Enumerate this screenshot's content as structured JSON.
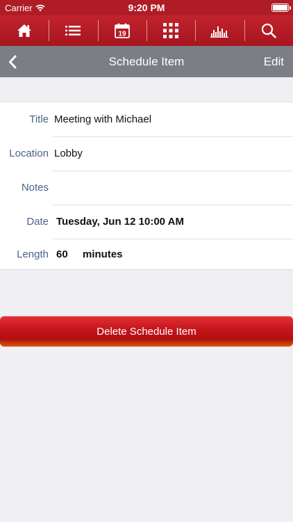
{
  "status_bar": {
    "carrier": "Carrier",
    "time": "9:20 PM"
  },
  "toolbar": {
    "icons": [
      "home-icon",
      "list-icon",
      "calendar-icon",
      "grid-icon",
      "chart-icon",
      "search-icon"
    ],
    "calendar_day": "19"
  },
  "nav": {
    "title": "Schedule Item",
    "edit_label": "Edit"
  },
  "form": {
    "title": {
      "label": "Title",
      "value": "Meeting with Michael"
    },
    "location": {
      "label": "Location",
      "value": "Lobby"
    },
    "notes": {
      "label": "Notes",
      "value": ""
    },
    "date": {
      "label": "Date",
      "value": "Tuesday, Jun 12 10:00 AM"
    },
    "length": {
      "label": "Length",
      "value": "60",
      "unit": "minutes"
    }
  },
  "delete_button": {
    "label": "Delete Schedule Item"
  },
  "colors": {
    "brand_red": "#b01c25",
    "navbar_gray": "#7b7f84",
    "label_blue": "#4a6489",
    "background": "#efeff4"
  }
}
